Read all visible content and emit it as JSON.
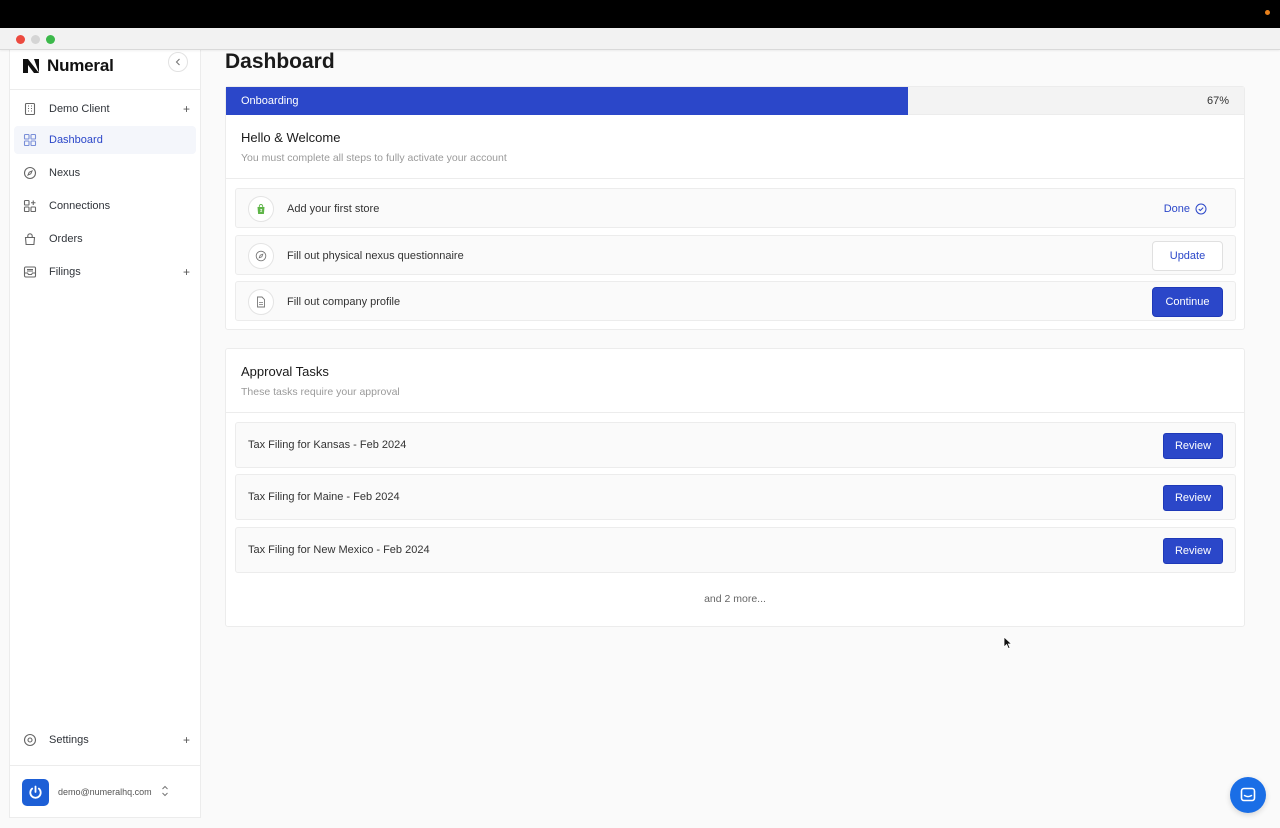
{
  "app": {
    "brand": "Numeral"
  },
  "sidebar": {
    "client": {
      "label": "Demo Client",
      "icon": "building-icon"
    },
    "items": [
      {
        "label": "Dashboard",
        "icon": "grid-icon",
        "active": true
      },
      {
        "label": "Nexus",
        "icon": "compass-icon"
      },
      {
        "label": "Connections",
        "icon": "connections-icon"
      },
      {
        "label": "Orders",
        "icon": "bag-icon"
      },
      {
        "label": "Filings",
        "icon": "inbox-icon",
        "expandable": true
      }
    ],
    "settings": {
      "label": "Settings",
      "icon": "gear-icon"
    },
    "user": {
      "email": "demo@numeralhq.com"
    }
  },
  "page": {
    "title": "Dashboard"
  },
  "onboarding": {
    "label": "Onboarding",
    "progress_percent": 67,
    "progress_text": "67%",
    "heading": "Hello & Welcome",
    "subheading": "You must complete all steps to fully activate your account",
    "steps": [
      {
        "label": "Add your first store",
        "icon": "shopify-icon",
        "status": "Done"
      },
      {
        "label": "Fill out physical nexus questionnaire",
        "icon": "compass-icon",
        "action": "Update"
      },
      {
        "label": "Fill out company profile",
        "icon": "document-icon",
        "action": "Continue"
      }
    ]
  },
  "approvals": {
    "heading": "Approval Tasks",
    "subheading": "These tasks require your approval",
    "tasks": [
      {
        "label": "Tax Filing for Kansas - Feb 2024",
        "action": "Review"
      },
      {
        "label": "Tax Filing for Maine - Feb 2024",
        "action": "Review"
      },
      {
        "label": "Tax Filing for New Mexico - Feb 2024",
        "action": "Review"
      }
    ],
    "more_text": "and 2 more..."
  },
  "colors": {
    "accent": "#2b47c9",
    "shopify": "#5fb548",
    "chat": "#1a6ee6"
  }
}
